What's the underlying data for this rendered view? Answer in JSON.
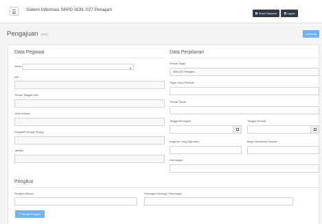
{
  "header": {
    "title": "Sistem Informasi SPPD SDN. 027 Penajam",
    "reset_password": "Reset Password",
    "logout": "Logout"
  },
  "page": {
    "title": "Pengajuan",
    "subtitle": "SPPD",
    "back": "Kembali"
  },
  "pegawai": {
    "title": "Data Pegawai",
    "nama_label": "Nama",
    "nip_label": "NIP",
    "nip_value": "-",
    "ttl_label": "Tempat Tanggal Lahir",
    "ttl_value": "-",
    "jk_label": "Jenis Kelamin",
    "jk_value": "-",
    "golongan_label": "Pangkat/Golongan Ruang",
    "golongan_value": "-",
    "jabatan_label": "Jabatan",
    "jabatan_value": "-"
  },
  "perjalanan": {
    "title": "Data Perjalanan",
    "tempat_tugas_label": "Tempat Tugas",
    "tempat_tugas_value": "SDN 027 Penajam",
    "tugas_label": "Tugas Yang Diberikan",
    "tujuan_label": "Tempat Tujuan",
    "berangkat_label": "Tanggal Berangkat",
    "kembali_label": "Tanggal Kembali",
    "angkutan_label": "Angkutan Yang Digunakan",
    "biaya_label": "Biaya Dibebankan Kepada",
    "keterangan_label": "Keterangan"
  },
  "pengikut": {
    "title": "Pengikut",
    "nama_label": "Pengikut (Nama)",
    "hubungan_label": "Hubungan Keluarga / Keterangan",
    "add_button": "Tambah Pengikut"
  }
}
